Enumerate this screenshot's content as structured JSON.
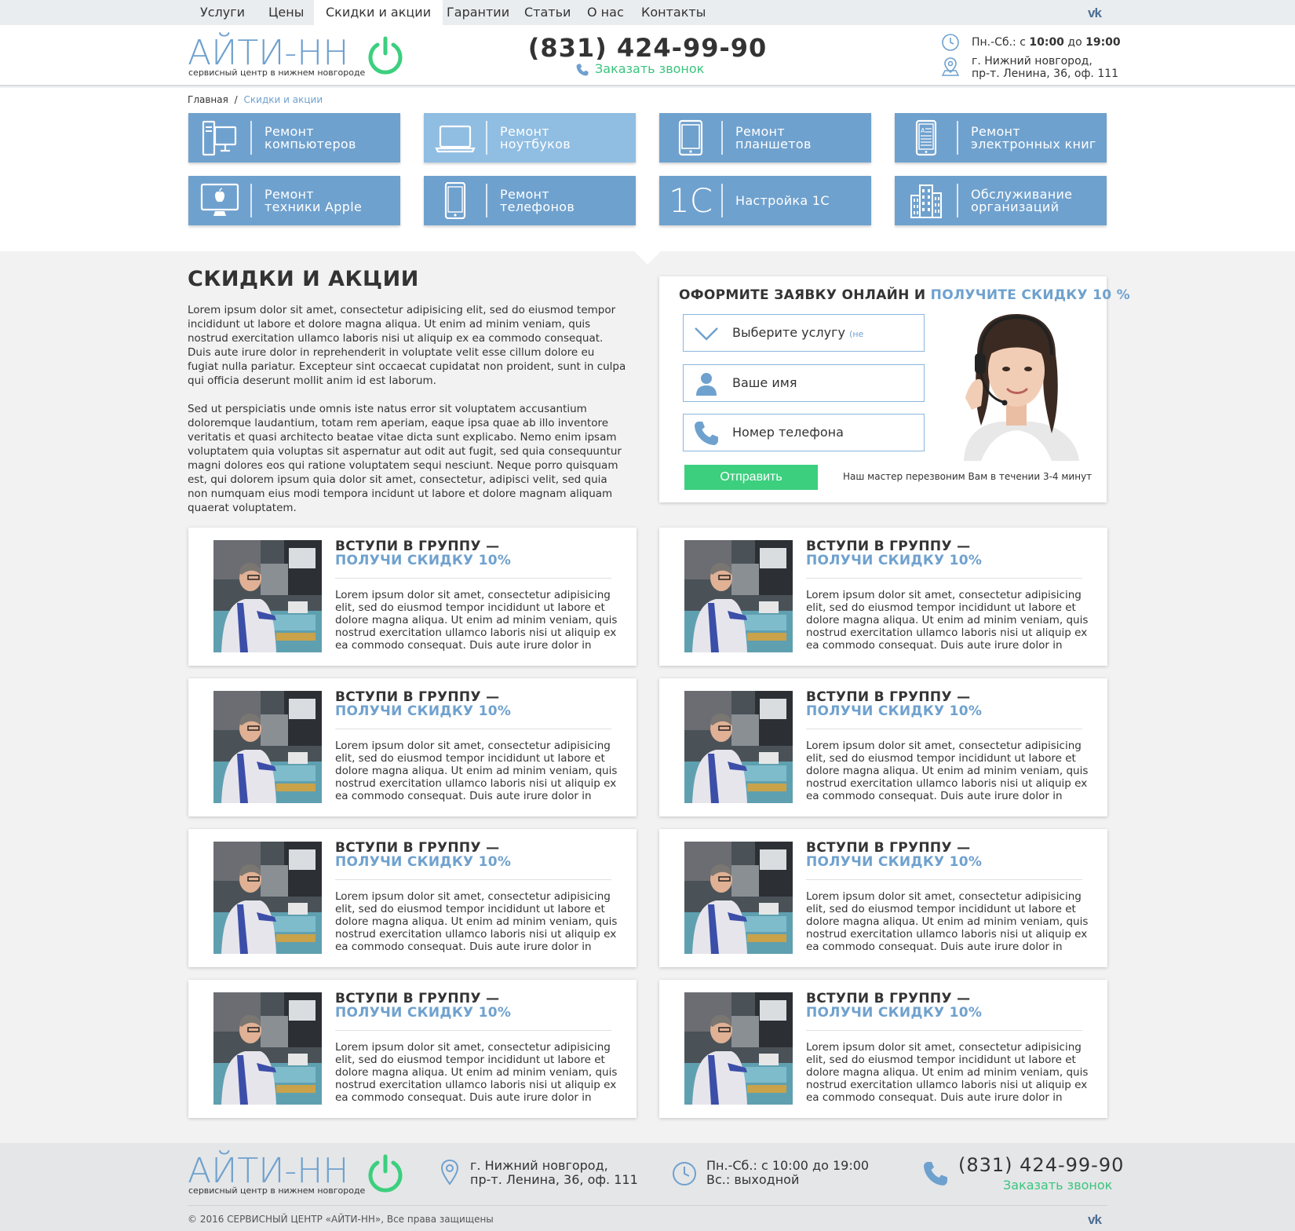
{
  "topnav": {
    "items": [
      "Услуги",
      "Цены",
      "Скидки и акции",
      "Гарантии",
      "Статьи",
      "О нас",
      "Контакты"
    ],
    "active_index": 2,
    "vk_label": "vk"
  },
  "header": {
    "logo_text": "АЙТИ-НН",
    "logo_sub": "сервисный центр в нижнем новгороде",
    "phone": "(831) 424-99-90",
    "callback": "Заказать звонок",
    "hours_prefix": "Пн.-Сб.: с ",
    "hours_from": "10:00",
    "hours_mid": " до ",
    "hours_to": "19:00",
    "address_line1": "г. Нижний новгород,",
    "address_line2": "пр-т. Ленина, 36, оф. 111"
  },
  "breadcrumb": {
    "home": "Главная",
    "sep": "/",
    "current": "Скидки и акции"
  },
  "services": [
    {
      "label": "Ремонт\nкомпьютеров",
      "icon": "desktop-computer-icon"
    },
    {
      "label": "Ремонт\nноутбуков",
      "icon": "laptop-icon"
    },
    {
      "label": "Ремонт\nпланшетов",
      "icon": "tablet-icon"
    },
    {
      "label": "Ремонт\nэлектронных книг",
      "icon": "ebook-icon"
    },
    {
      "label": "Ремонт\nтехники Apple",
      "icon": "apple-monitor-icon"
    },
    {
      "label": "Ремонт\nтелефонов",
      "icon": "smartphone-icon"
    },
    {
      "label": "Настройка 1С",
      "icon": "1c-icon",
      "icon_text": "1С"
    },
    {
      "label": "Обслуживание\nорганизаций",
      "icon": "office-building-icon"
    }
  ],
  "main": {
    "title": "СКИДКИ И АКЦИИ",
    "paragraph1": "Lorem ipsum dolor sit amet, consectetur adipisicing elit, sed do eiusmod tempor incididunt ut labore et dolore magna aliqua. Ut enim ad minim veniam, quis nostrud exercitation ullamco laboris nisi ut aliquip ex ea commodo consequat. Duis aute irure dolor in reprehenderit in voluptate velit esse cillum dolore eu fugiat nulla pariatur. Excepteur sint occaecat cupidatat non proident, sunt in culpa qui officia deserunt mollit anim id est laborum.",
    "paragraph2": "Sed ut perspiciatis unde omnis iste natus error sit voluptatem accusantium doloremque laudantium, totam rem aperiam, eaque ipsa quae ab illo inventore veritatis et quasi architecto beatae vitae dicta sunt explicabo. Nemo enim ipsam voluptatem quia voluptas sit aspernatur aut odit aut fugit, sed quia consequuntur magni dolores eos qui ratione voluptatem sequi nesciunt. Neque porro quisquam est, qui dolorem ipsum quia dolor sit amet, consectetur, adipisci velit, sed quia non numquam eius modi tempora incidunt ut labore et dolore magnam aliquam quaerat voluptatem."
  },
  "form": {
    "heading_a": "ОФОРМИТЕ ЗАЯВКУ ОНЛАЙН И ",
    "heading_b": "ПОЛУЧИТЕ СКИДКУ 10 %",
    "service_select": "Выберите услугу",
    "service_optional": "(не обязательно)",
    "name_placeholder": "Ваше имя",
    "phone_placeholder": "Номер телефона",
    "submit": "Отправить",
    "note": "Наш мастер перезвоним Вам в течении 3-4 минут"
  },
  "cards": [
    {
      "title1": "ВСТУПИ В ГРУППУ —",
      "title2": "ПОЛУЧИ СКИДКУ 10%",
      "text": "Lorem ipsum dolor sit amet, consectetur adipisicing elit, sed do eiusmod tempor incididunt ut labore et dolore magna aliqua. Ut enim ad minim veniam, quis nostrud exercitation ullamco laboris nisi ut aliquip ex ea commodo consequat. Duis aute irure dolor in"
    },
    {
      "title1": "ВСТУПИ В ГРУППУ —",
      "title2": "ПОЛУЧИ СКИДКУ 10%",
      "text": "Lorem ipsum dolor sit amet, consectetur adipisicing elit, sed do eiusmod tempor incididunt ut labore et dolore magna aliqua. Ut enim ad minim veniam, quis nostrud exercitation ullamco laboris nisi ut aliquip ex ea commodo consequat. Duis aute irure dolor in"
    },
    {
      "title1": "ВСТУПИ В ГРУППУ —",
      "title2": "ПОЛУЧИ СКИДКУ 10%",
      "text": "Lorem ipsum dolor sit amet, consectetur adipisicing elit, sed do eiusmod tempor incididunt ut labore et dolore magna aliqua. Ut enim ad minim veniam, quis nostrud exercitation ullamco laboris nisi ut aliquip ex ea commodo consequat. Duis aute irure dolor in"
    },
    {
      "title1": "ВСТУПИ В ГРУППУ —",
      "title2": "ПОЛУЧИ СКИДКУ 10%",
      "text": "Lorem ipsum dolor sit amet, consectetur adipisicing elit, sed do eiusmod tempor incididunt ut labore et dolore magna aliqua. Ut enim ad minim veniam, quis nostrud exercitation ullamco laboris nisi ut aliquip ex ea commodo consequat. Duis aute irure dolor in"
    },
    {
      "title1": "ВСТУПИ В ГРУППУ —",
      "title2": "ПОЛУЧИ СКИДКУ 10%",
      "text": "Lorem ipsum dolor sit amet, consectetur adipisicing elit, sed do eiusmod tempor incididunt ut labore et dolore magna aliqua. Ut enim ad minim veniam, quis nostrud exercitation ullamco laboris nisi ut aliquip ex ea commodo consequat. Duis aute irure dolor in"
    },
    {
      "title1": "ВСТУПИ В ГРУППУ —",
      "title2": "ПОЛУЧИ СКИДКУ 10%",
      "text": "Lorem ipsum dolor sit amet, consectetur adipisicing elit, sed do eiusmod tempor incididunt ut labore et dolore magna aliqua. Ut enim ad minim veniam, quis nostrud exercitation ullamco laboris nisi ut aliquip ex ea commodo consequat. Duis aute irure dolor in"
    },
    {
      "title1": "ВСТУПИ В ГРУППУ —",
      "title2": "ПОЛУЧИ СКИДКУ 10%",
      "text": "Lorem ipsum dolor sit amet, consectetur adipisicing elit, sed do eiusmod tempor incididunt ut labore et dolore magna aliqua. Ut enim ad minim veniam, quis nostrud exercitation ullamco laboris nisi ut aliquip ex ea commodo consequat. Duis aute irure dolor in"
    },
    {
      "title1": "ВСТУПИ В ГРУППУ —",
      "title2": "ПОЛУЧИ СКИДКУ 10%",
      "text": "Lorem ipsum dolor sit amet, consectetur adipisicing elit, sed do eiusmod tempor incididunt ut labore et dolore magna aliqua. Ut enim ad minim veniam, quis nostrud exercitation ullamco laboris nisi ut aliquip ex ea commodo consequat. Duis aute irure dolor in"
    }
  ],
  "footer": {
    "logo_text": "АЙТИ-НН",
    "logo_sub": "сервисный центр в нижнем новгороде",
    "address_line1": "г. Нижний новгород,",
    "address_line2": "пр-т. Ленина, 36, оф. 111",
    "hours_line1": "Пн.-Сб.: с 10:00 до 19:00",
    "hours_line2": "Вс.: выходной",
    "phone": "(831) 424-99-90",
    "callback": "Заказать звонок",
    "copyright": "© 2016 СЕРВИСНЫЙ ЦЕНТР «АЙТИ-НН», Все права защищены",
    "vk_label": "vk"
  },
  "colors": {
    "accent_blue": "#6fa1ce",
    "accent_green": "#3ccf7e",
    "tile_highlight": "#90bde2"
  }
}
